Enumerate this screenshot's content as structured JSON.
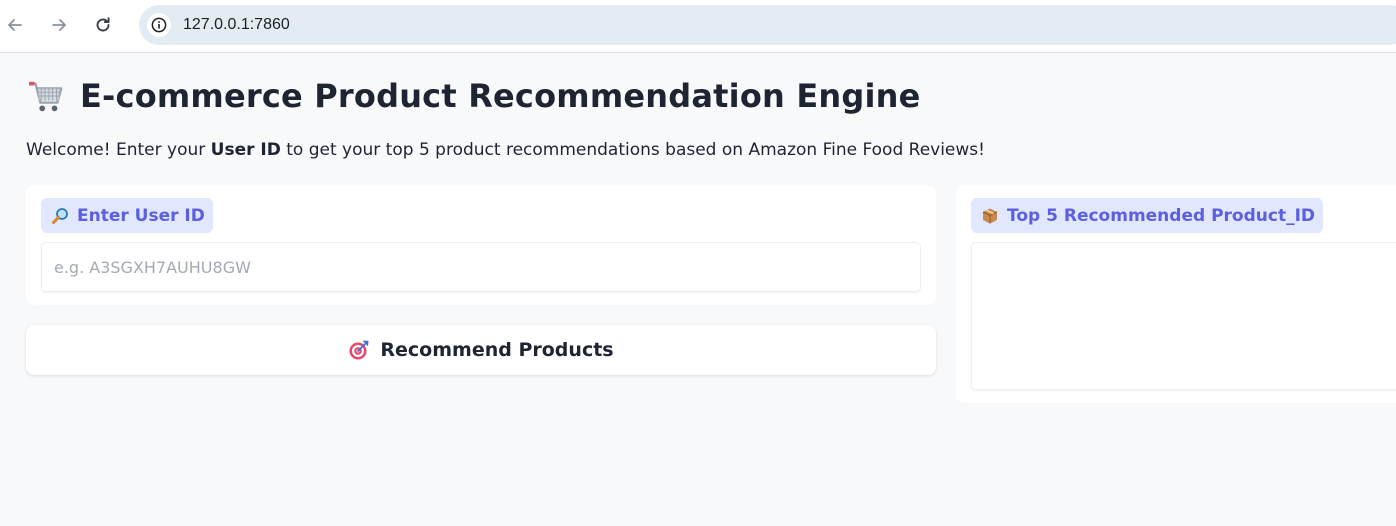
{
  "browser": {
    "url": "127.0.0.1:7860",
    "icons": [
      "back-arrow-icon",
      "forward-arrow-icon",
      "reload-icon",
      "info-icon"
    ]
  },
  "page": {
    "title": "E-commerce Product Recommendation Engine",
    "title_icon": "shopping-cart-icon",
    "welcome_prefix": "Welcome! Enter your ",
    "welcome_bold": "User ID",
    "welcome_suffix": " to get your top 5 product recommendations based on Amazon Fine Food Reviews!"
  },
  "input_panel": {
    "label": "Enter User ID",
    "label_icon": "magnifier-icon",
    "placeholder": "e.g. A3SGXH7AUHU8GW",
    "value": ""
  },
  "button": {
    "label": "Recommend Products",
    "icon": "target-icon"
  },
  "output_panel": {
    "label": "Top 5 Recommended Product_ID",
    "label_icon": "package-icon",
    "value": ""
  },
  "colors": {
    "accent": "#5b5fe0",
    "chip_bg": "#e0e7ff",
    "page_bg": "#f8f9fb",
    "url_bar_bg": "#e3ebf3"
  }
}
